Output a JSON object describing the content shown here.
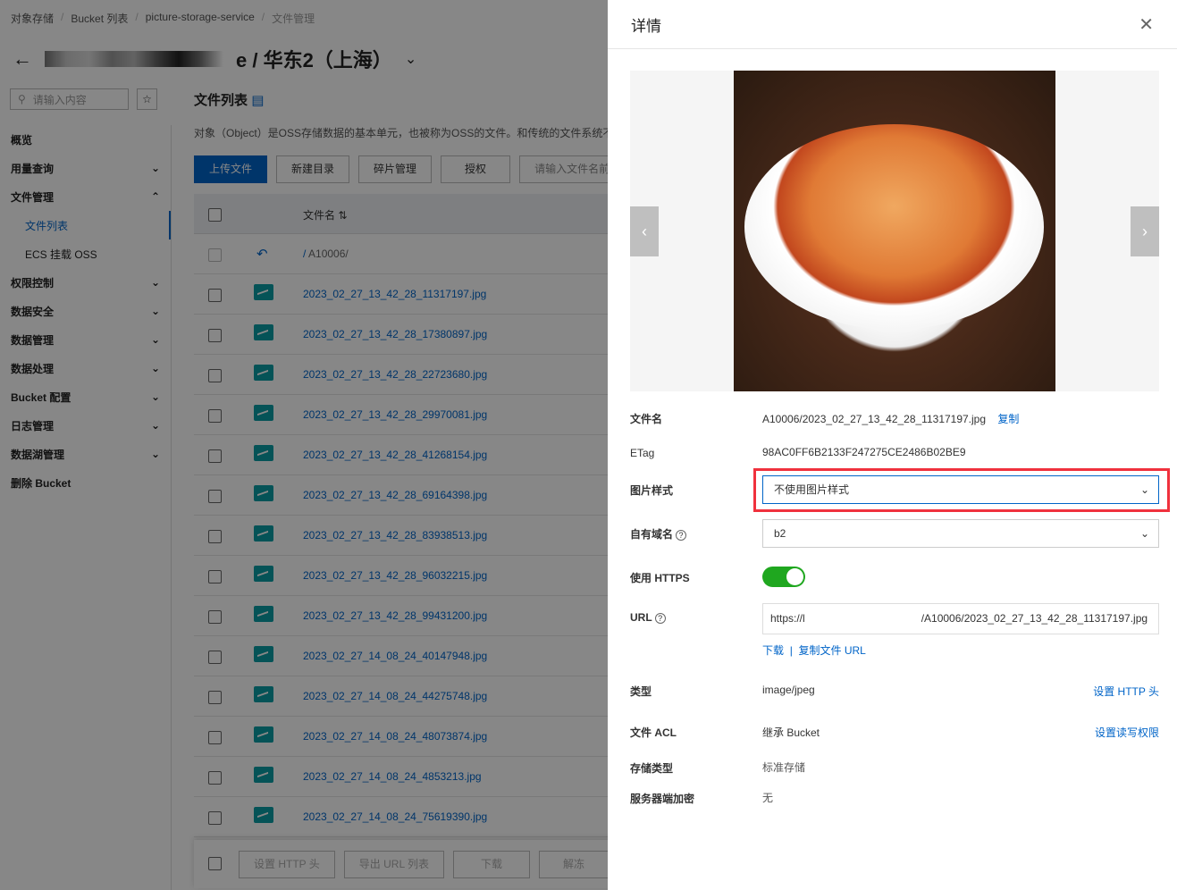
{
  "breadcrumb": [
    "对象存储",
    "Bucket 列表",
    "picture-storage-service",
    "文件管理"
  ],
  "header": {
    "title_suffix": "e / 华东2（上海）"
  },
  "sidebar": {
    "search_placeholder": "请输入内容",
    "items": [
      {
        "label": "概览"
      },
      {
        "label": "用量查询"
      },
      {
        "label": "文件管理"
      },
      {
        "label": "文件列表"
      },
      {
        "label": "ECS 挂载 OSS"
      },
      {
        "label": "权限控制"
      },
      {
        "label": "数据安全"
      },
      {
        "label": "数据管理"
      },
      {
        "label": "数据处理"
      },
      {
        "label": "Bucket 配置"
      },
      {
        "label": "日志管理"
      },
      {
        "label": "数据湖管理"
      },
      {
        "label": "删除 Bucket"
      }
    ]
  },
  "main": {
    "title": "文件列表",
    "description": "对象（Object）是OSS存储数据的基本单元，也被称为OSS的文件。和传统的文件系统不",
    "buttons": [
      "上传文件",
      "新建目录",
      "碎片管理",
      "授权"
    ],
    "search_placeholder": "请输入文件名前缀",
    "column_filename": "文件名",
    "parent_dir": "A10006/",
    "files": [
      "2023_02_27_13_42_28_11317197.jpg",
      "2023_02_27_13_42_28_17380897.jpg",
      "2023_02_27_13_42_28_22723680.jpg",
      "2023_02_27_13_42_28_29970081.jpg",
      "2023_02_27_13_42_28_41268154.jpg",
      "2023_02_27_13_42_28_69164398.jpg",
      "2023_02_27_13_42_28_83938513.jpg",
      "2023_02_27_13_42_28_96032215.jpg",
      "2023_02_27_13_42_28_99431200.jpg",
      "2023_02_27_14_08_24_40147948.jpg",
      "2023_02_27_14_08_24_44275748.jpg",
      "2023_02_27_14_08_24_48073874.jpg",
      "2023_02_27_14_08_24_4853213.jpg",
      "2023_02_27_14_08_24_75619390.jpg"
    ],
    "footer_buttons": [
      "设置 HTTP 头",
      "导出 URL 列表",
      "下载",
      "解冻"
    ]
  },
  "drawer": {
    "title": "详情",
    "filename_label": "文件名",
    "filename": "A10006/2023_02_27_13_42_28_11317197.jpg",
    "copy": "复制",
    "etag_label": "ETag",
    "etag": "98AC0FF6B2133F247275CE2486B02BE9",
    "style_label": "图片样式",
    "style_value": "不使用图片样式",
    "domain_label": "自有域名",
    "domain_value": "b2",
    "https_label": "使用 HTTPS",
    "https_on": true,
    "url_label": "URL",
    "url_prefix": "https://l",
    "url_suffix": "/A10006/2023_02_27_13_42_28_11317197.jpg",
    "download": "下载",
    "copy_url": "复制文件 URL",
    "type_label": "类型",
    "type": "image/jpeg",
    "set_http": "设置 HTTP 头",
    "acl_label": "文件 ACL",
    "acl": "继承 Bucket",
    "set_acl": "设置读写权限",
    "storage_label": "存储类型",
    "storage": "标准存储",
    "encrypt_label": "服务器端加密",
    "encrypt": "无"
  }
}
